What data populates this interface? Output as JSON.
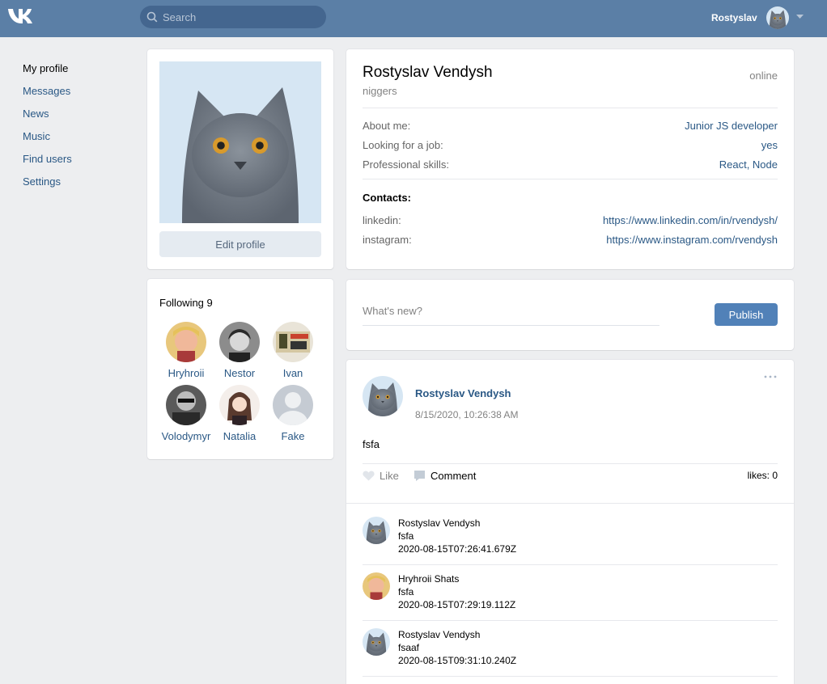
{
  "header": {
    "search_placeholder": "Search",
    "user_name": "Rostyslav"
  },
  "sidebar": {
    "items": [
      {
        "label": "My profile"
      },
      {
        "label": "Messages"
      },
      {
        "label": "News"
      },
      {
        "label": "Music"
      },
      {
        "label": "Find users"
      },
      {
        "label": "Settings"
      }
    ]
  },
  "avatar_card": {
    "edit_label": "Edit profile"
  },
  "following": {
    "title": "Following 9",
    "friends": [
      {
        "name": "Hryhroii"
      },
      {
        "name": "Nestor"
      },
      {
        "name": "Ivan"
      },
      {
        "name": "Volodymyr"
      },
      {
        "name": "Natalia"
      },
      {
        "name": "Fake"
      }
    ]
  },
  "profile": {
    "name": "Rostyslav Vendysh",
    "status": "niggers",
    "online": "online",
    "about_label": "About me:",
    "about_value": "Junior JS developer",
    "job_label": "Looking for a job:",
    "job_value": "yes",
    "skills_label": "Professional skills:",
    "skills_value": "React, Node",
    "contacts_title": "Contacts:",
    "contacts": [
      {
        "label": "linkedin:",
        "value": "https://www.linkedin.com/in/rvendysh/"
      },
      {
        "label": "instagram:",
        "value": "https://www.instagram.com/rvendysh"
      }
    ]
  },
  "new_post": {
    "placeholder": "What's new?",
    "publish_label": "Publish"
  },
  "post": {
    "author": "Rostyslav Vendysh",
    "date": "8/15/2020, 10:26:38 AM",
    "text": "fsfa",
    "like_label": "Like",
    "comment_label": "Comment",
    "likes": "likes: 0",
    "comments": [
      {
        "author": "Rostyslav Vendysh",
        "text": "fsfa",
        "time": "2020-08-15T07:26:41.679Z"
      },
      {
        "author": "Hryhroii Shats",
        "text": "fsfa",
        "time": "2020-08-15T07:29:19.112Z"
      },
      {
        "author": "Rostyslav Vendysh",
        "text": "fsaaf",
        "time": "2020-08-15T09:31:10.240Z"
      }
    ]
  },
  "colors": {
    "header_bg": "#5b7fa6",
    "link": "#2a5885",
    "button": "#5181b8",
    "page_bg": "#edeef0"
  }
}
